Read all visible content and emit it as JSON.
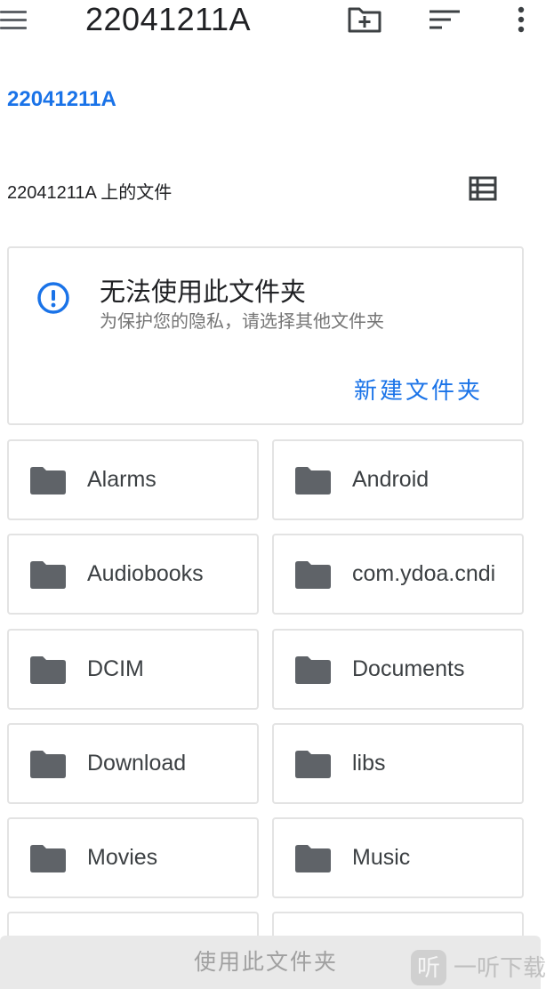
{
  "appbar": {
    "title": "22041211A",
    "icons": [
      "menu-icon",
      "create-new-folder-icon",
      "sort-icon",
      "more-vert-icon"
    ]
  },
  "breadcrumb": {
    "root": "22041211A"
  },
  "section": {
    "title": "22041211A 上的文件",
    "view_icon": "list-view-icon"
  },
  "warning": {
    "icon": "info-icon",
    "title": "无法使用此文件夹",
    "subtitle": "为保护您的隐私，请选择其他文件夹",
    "action_label": "新建文件夹"
  },
  "folders": [
    {
      "name": "Alarms"
    },
    {
      "name": "Android"
    },
    {
      "name": "Audiobooks"
    },
    {
      "name": "com.ydoa.cndi"
    },
    {
      "name": "DCIM"
    },
    {
      "name": "Documents"
    },
    {
      "name": "Download"
    },
    {
      "name": "libs"
    },
    {
      "name": "Movies"
    },
    {
      "name": "Music"
    }
  ],
  "bottom": {
    "use_folder_label": "使用此文件夹"
  },
  "watermark": {
    "logo_char": "听",
    "text": "一听下载"
  },
  "colors": {
    "accent": "#1a73e8",
    "folder": "#5f6368",
    "border": "#e3e3e3",
    "disabled_text": "#a0a0a0"
  }
}
